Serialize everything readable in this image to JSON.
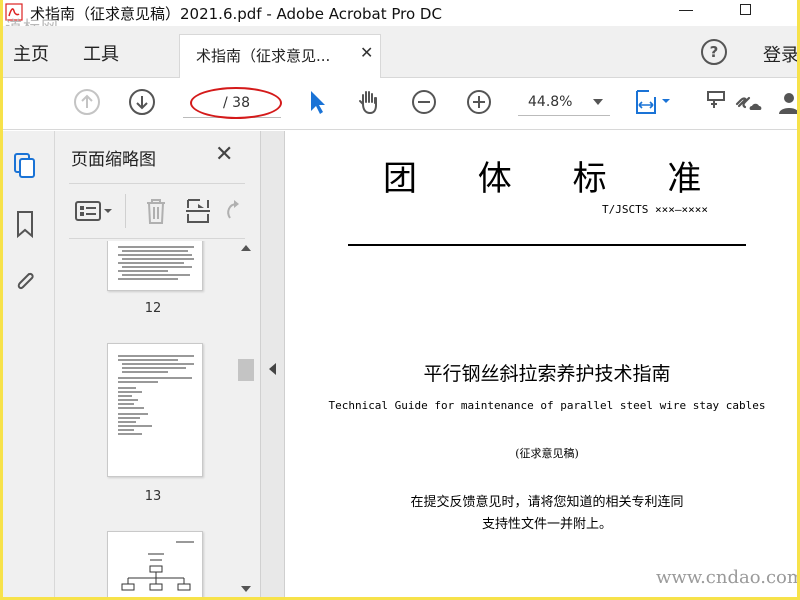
{
  "window": {
    "title": "术指南（征求意见稿）2021.6.pdf - Adobe Acrobat Pro DC",
    "watermark_top": "道标网",
    "watermark_bottom": "www.cndao.com"
  },
  "nav": {
    "home": "主页",
    "tools": "工具",
    "doc_tab": "术指南（征求意见...",
    "login": "登录",
    "help": "?"
  },
  "toolbar": {
    "page_input": "",
    "page_total": "/ 38",
    "zoom": "44.8%"
  },
  "thumbnails": {
    "title": "页面缩略图",
    "pages": [
      {
        "number": "12"
      },
      {
        "number": "13"
      }
    ]
  },
  "document": {
    "heading": "团 体 标 准",
    "code": "T/JSCTS ×××—××××",
    "title_cn": "平行钢丝斜拉索养护技术指南",
    "title_en": "Technical Guide for maintenance of parallel steel wire stay cables",
    "status": "(征求意见稿)",
    "notice_line1": "在提交反馈意见时，请将您知道的相关专利连同",
    "notice_line2": "支持性文件一并附上。"
  },
  "colors": {
    "accent_blue": "#1a73d6",
    "highlight_red": "#d41a1a",
    "frame_yellow": "#f7e24a"
  }
}
